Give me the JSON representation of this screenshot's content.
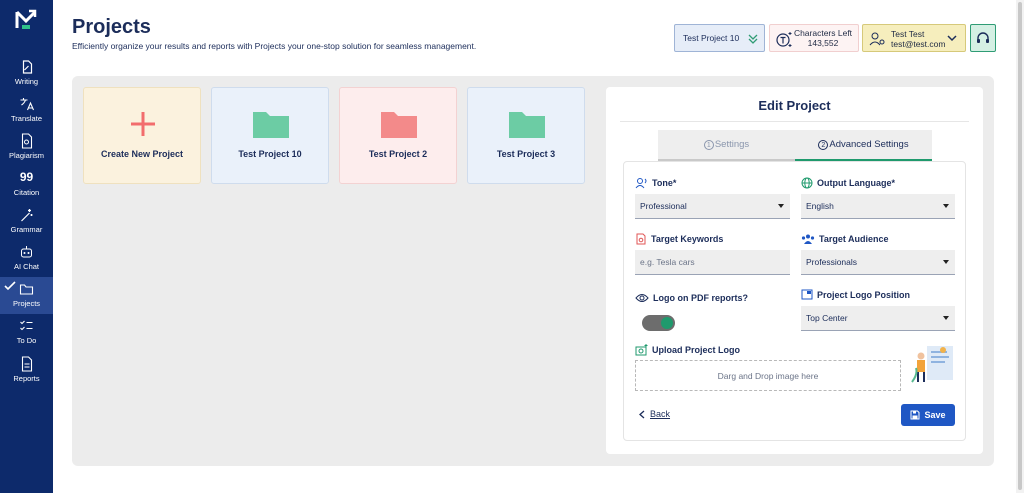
{
  "sidebar": {
    "items": [
      {
        "label": "Writing",
        "icon": "writing-icon"
      },
      {
        "label": "Translate",
        "icon": "translate-icon"
      },
      {
        "label": "Plagiarism",
        "icon": "plagiarism-icon"
      },
      {
        "label": "Citation",
        "icon": "quote-icon"
      },
      {
        "label": "Grammar",
        "icon": "magic-wand-icon"
      },
      {
        "label": "AI Chat",
        "icon": "robot-icon"
      },
      {
        "label": "Projects",
        "icon": "folder-icon",
        "active": true
      },
      {
        "label": "To Do",
        "icon": "checklist-icon"
      },
      {
        "label": "Reports",
        "icon": "report-icon"
      }
    ]
  },
  "header": {
    "title": "Projects",
    "subtitle": "Efficiently organize your results and reports with Projects your one-stop solution for seamless management.",
    "project_selector": "Test Project 10",
    "characters_label": "Characters Left",
    "characters_value": "143,552",
    "user_name": "Test Test",
    "user_email": "test@test.com"
  },
  "cards": [
    {
      "label": "Create New Project",
      "icon": "plus-icon"
    },
    {
      "label": "Test Project 10",
      "icon": "folder-icon"
    },
    {
      "label": "Test Project 2",
      "icon": "folder-icon"
    },
    {
      "label": "Test Project 3",
      "icon": "folder-icon"
    }
  ],
  "edit": {
    "title": "Edit Project",
    "tabs": {
      "settings": "Settings",
      "advanced": "Advanced Settings"
    },
    "tone_label": "Tone*",
    "tone_value": "Professional",
    "language_label": "Output Language*",
    "language_value": "English",
    "keywords_label": "Target Keywords",
    "keywords_placeholder": "e.g. Tesla cars",
    "audience_label": "Target Audience",
    "audience_value": "Professionals",
    "logo_pdf_label": "Logo on PDF reports?",
    "logo_position_label": "Project Logo Position",
    "logo_position_value": "Top Center",
    "upload_label": "Upload Project Logo",
    "dropzone_text": "Darg and Drop image here",
    "back_label": "Back",
    "save_label": "Save"
  },
  "colors": {
    "sidebar": "#0d2a6b",
    "accent_green": "#1f9a6d",
    "save_blue": "#1f57c4",
    "folder_green": "#6ccca4",
    "folder_red": "#f38a8a",
    "plus_red": "#f26d6d"
  }
}
